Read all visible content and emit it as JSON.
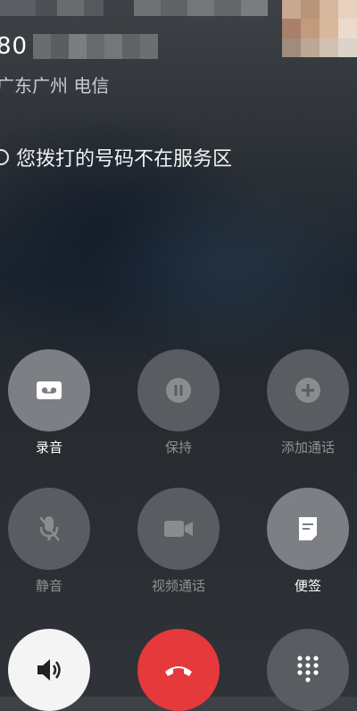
{
  "call": {
    "number_visible": "80",
    "location": "广东广州 电信",
    "status": "您拨打的号码不在服务区"
  },
  "controls": {
    "record": "录音",
    "hold": "保持",
    "add_call": "添加通话",
    "mute": "静音",
    "video_call": "视频通话",
    "notes": "便签"
  },
  "colors": {
    "end_call": "#e5393c",
    "active_button": "#7c7f83",
    "disabled_button": "#595c60"
  },
  "icons": {
    "record": "voicemail-icon",
    "hold": "pause-icon",
    "add_call": "plus-icon",
    "mute": "mic-off-icon",
    "video_call": "video-camera-icon",
    "notes": "note-icon",
    "speaker": "speaker-icon",
    "end_call": "hangup-icon",
    "dialpad": "dialpad-icon"
  }
}
